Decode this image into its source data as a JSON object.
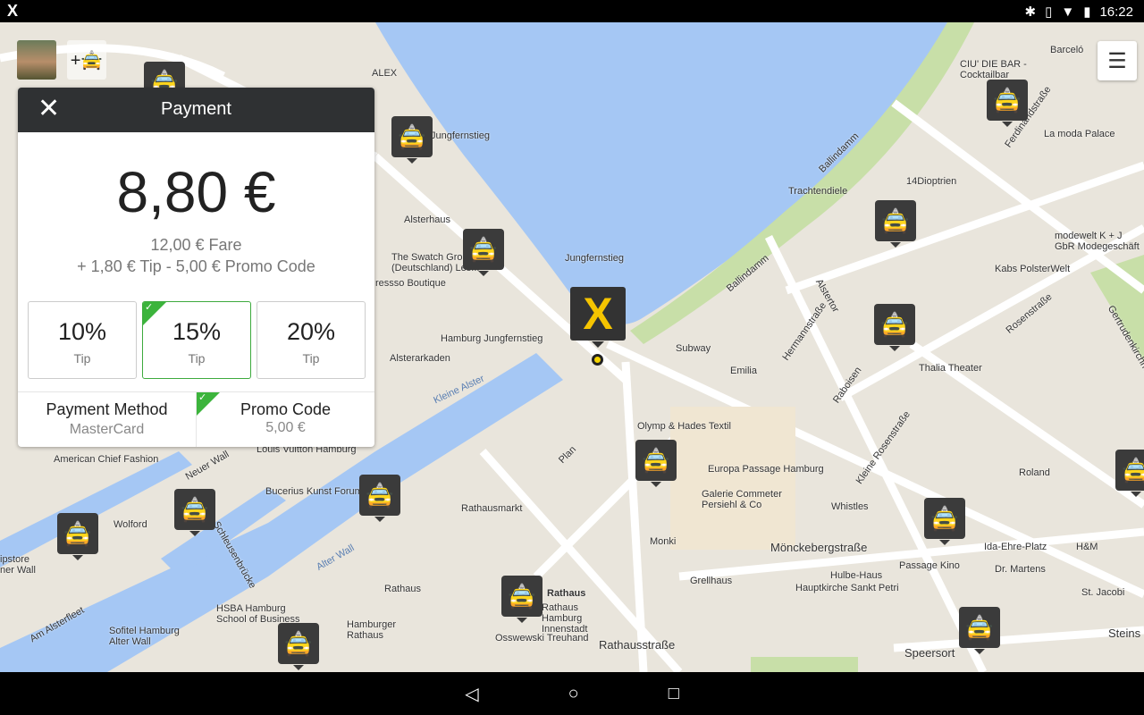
{
  "status": {
    "app_icon": "mytaxi-x-icon",
    "time": "16:22",
    "icons": [
      "bluetooth-icon",
      "vibrate-icon",
      "wifi-icon",
      "battery-icon"
    ]
  },
  "nav": {
    "back": "◁",
    "home": "○",
    "recents": "□"
  },
  "map": {
    "labels": [
      "ALEX",
      "Jungfernstieg",
      "Alsterhaus",
      "The Swatch Group (Deutschland) Les...",
      "ressso Boutique",
      "Jungfernstieg",
      "Hamburg Jungfernstieg",
      "Alsterarkaden",
      "Kleine Alster",
      "American Chief Fashion",
      "Louis Vuitton Hamburg",
      "Bucerius Kunst Forum",
      "Wolford",
      "Rathausmarkt",
      "Alter Wall",
      "Rathaus",
      "HSBA Hamburg School of Business",
      "Sofitel Hamburg Alter Wall",
      "Hamburger Rathaus",
      "Rathaus",
      "Rathaus Hamburg Innenstadt",
      "Osswewski Treuhand",
      "Rathausstraße",
      "Subway",
      "Emilia",
      "Olymp & Hades Textil",
      "Europa Passage Hamburg",
      "Galerie Commeter Persiehl & Co",
      "Monki",
      "Grellhaus",
      "Hulbe-Haus",
      "Hauptkirche Sankt Petri",
      "Passage Kino",
      "Dr. Martens",
      "Ida-Ehre-Platz",
      "H&M",
      "St. Jacobi",
      "Mönckebergstraße",
      "Whistles",
      "Roland",
      "Thalia Theater",
      "Kabs PolsterWelt",
      "modewelt K + J GbR Modegeschäft",
      "14Dioptrien",
      "Trachtendiele",
      "La moda Palace",
      "CIU' DIE BAR - Cocktailbar",
      "Barceló",
      "Ballindamm",
      "Ballindamm",
      "Hermannstraße",
      "Alstertor",
      "Raboisen",
      "Rosenstraße",
      "Kleine Rosenstraße",
      "Speersort",
      "Plan",
      "Ferdinandstraße",
      "Gertrudenkirchhof",
      "Steins",
      "Am Alsterfleet",
      "Neuer Wall",
      "Schleusenbrücke",
      "ipstore ner Wall"
    ],
    "marker_icon": "taxi-icon",
    "center_marker_icon": "mytaxi-x-marker",
    "menu_icon": "hamburger-menu-icon",
    "add_taxi_icon": "add-taxi-icon"
  },
  "payment": {
    "title": "Payment",
    "close_icon": "close-icon",
    "amount": "8,80 €",
    "fare": "12,00 € Fare",
    "breakdown": "+ 1,80 € Tip - 5,00 € Promo Code",
    "tips": [
      {
        "pct": "10%",
        "label": "Tip",
        "selected": false
      },
      {
        "pct": "15%",
        "label": "Tip",
        "selected": true
      },
      {
        "pct": "20%",
        "label": "Tip",
        "selected": false
      }
    ],
    "method_label": "Payment Method",
    "method_value": "MasterCard",
    "promo_label": "Promo Code",
    "promo_value": "5,00 €",
    "promo_applied": true,
    "accent": "#3cb43c"
  }
}
